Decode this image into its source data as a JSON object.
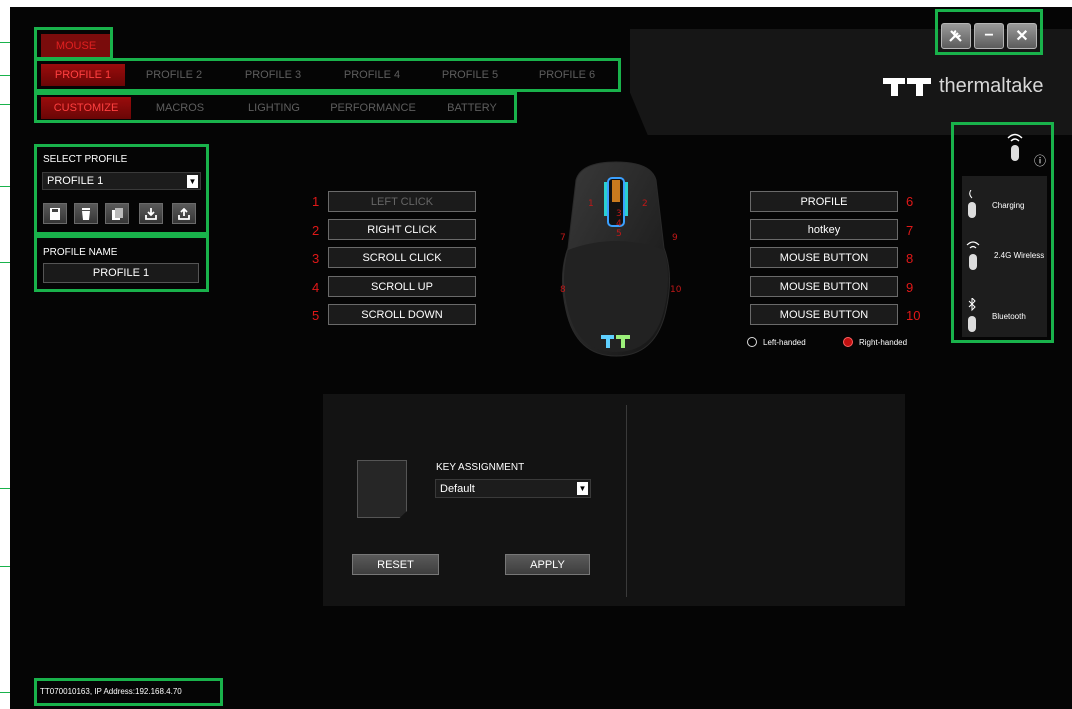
{
  "nav": {
    "mouse_tab": "MOUSE",
    "profiles": [
      "PROFILE 1",
      "PROFILE 2",
      "PROFILE 3",
      "PROFILE 4",
      "PROFILE 5",
      "PROFILE 6"
    ],
    "sections": [
      "CUSTOMIZE",
      "MACROS",
      "LIGHTING",
      "PERFORMANCE",
      "BATTERY"
    ]
  },
  "brand": {
    "name": "thermaltake"
  },
  "window": {
    "icons": [
      "tools-icon",
      "minimize-icon",
      "close-icon"
    ],
    "minimize": "−",
    "close": "✕"
  },
  "select_profile": {
    "label": "SELECT PROFILE",
    "value": "PROFILE 1",
    "actions": [
      "save-icon",
      "delete-icon",
      "copy-icon",
      "import-icon",
      "export-icon"
    ]
  },
  "profile_name": {
    "label": "PROFILE NAME",
    "value": "PROFILE 1"
  },
  "buttons_left": [
    {
      "num": "1",
      "label": "LEFT CLICK"
    },
    {
      "num": "2",
      "label": "RIGHT CLICK"
    },
    {
      "num": "3",
      "label": "SCROLL CLICK"
    },
    {
      "num": "4",
      "label": "SCROLL UP"
    },
    {
      "num": "5",
      "label": "SCROLL DOWN"
    }
  ],
  "buttons_right": [
    {
      "num": "6",
      "label": "PROFILE"
    },
    {
      "num": "7",
      "label": "hotkey"
    },
    {
      "num": "8",
      "label": "MOUSE BUTTON"
    },
    {
      "num": "9",
      "label": "MOUSE BUTTON"
    },
    {
      "num": "10",
      "label": "MOUSE BUTTON"
    }
  ],
  "mouse_markers": [
    "1",
    "2",
    "3",
    "4",
    "5",
    "7",
    "8",
    "9",
    "10"
  ],
  "handedness": {
    "left": "Left-handed",
    "right": "Right-handed",
    "selected": "right"
  },
  "device_status": {
    "info": "ⓘ",
    "modes": [
      "Charging",
      "2.4G Wireless",
      "Bluetooth"
    ]
  },
  "key_assignment": {
    "label": "KEY ASSIGNMENT",
    "value": "Default"
  },
  "actions": {
    "reset": "RESET",
    "apply": "APPLY"
  },
  "status_bar": "TT070010163, IP Address:192.168.4.70",
  "colors": {
    "accent": "#e01818",
    "highlight": "#19b24b",
    "background": "#050505"
  }
}
